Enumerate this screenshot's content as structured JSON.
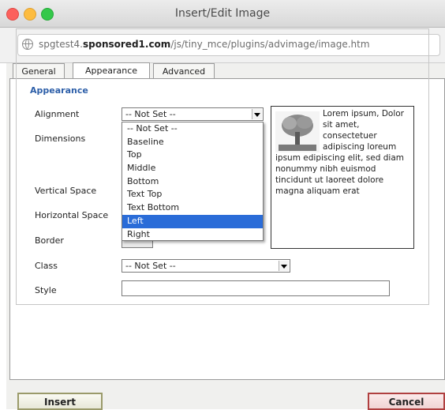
{
  "window": {
    "title": "Insert/Edit Image"
  },
  "url": {
    "host_prefix": "spgtest4.",
    "host_domain": "sponsored1.com",
    "path": "/js/tiny_mce/plugins/advimage/image.htm"
  },
  "tabs": [
    "General",
    "Appearance",
    "Advanced"
  ],
  "appearance": {
    "legend": "Appearance",
    "labels": {
      "alignment": "Alignment",
      "dimensions": "Dimensions",
      "vspace": "Vertical Space",
      "hspace": "Horizontal Space",
      "border": "Border",
      "class": "Class",
      "style": "Style"
    },
    "alignment_value": "-- Not Set --",
    "alignment_options": [
      "-- Not Set --",
      "Baseline",
      "Top",
      "Middle",
      "Bottom",
      "Text Top",
      "Text Bottom",
      "Left",
      "Right"
    ],
    "highlighted_option": "Left",
    "class_value": "-- Not Set --",
    "style_value": ""
  },
  "preview": {
    "text": "Lorem ipsum, Dolor sit amet, consectetuer adipiscing loreum ipsum edipiscing elit, sed diam nonummy nibh euismod tincidunt ut laoreet dolore magna aliquam erat"
  },
  "buttons": {
    "insert": "Insert",
    "cancel": "Cancel"
  },
  "colors": {
    "legend": "#2c5ea8",
    "highlight": "#2a6cd8",
    "cancel_border": "#b04040"
  }
}
